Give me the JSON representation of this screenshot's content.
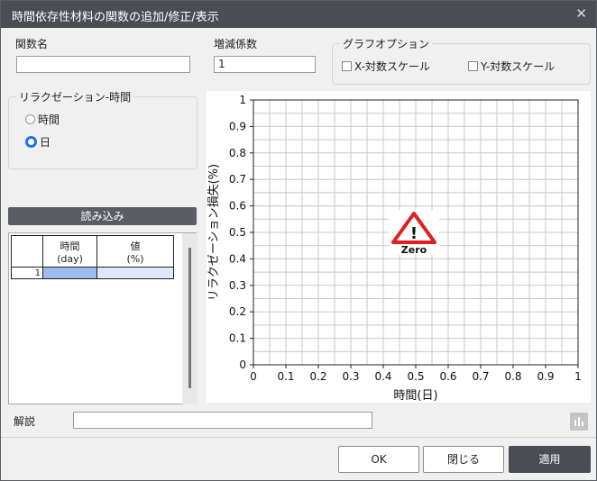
{
  "title": "時間依存性材料の関数の追加/修正/表示",
  "labels": {
    "function_name": "関数名",
    "coefficient": "増減係数",
    "graph_options": "グラフオプション",
    "relaxation_time": "リラクゼーション-時間",
    "description": "解説"
  },
  "inputs": {
    "function_name_value": "",
    "coefficient_value": "1",
    "description_value": ""
  },
  "graph_options": {
    "x_log": {
      "label": "X-対数スケール",
      "checked": false
    },
    "y_log": {
      "label": "Y-対数スケール",
      "checked": false
    }
  },
  "relaxation_units": [
    {
      "label": "時間",
      "selected": false
    },
    {
      "label": "日",
      "selected": true
    }
  ],
  "load_button": "読み込み",
  "table": {
    "headers": [
      [
        "時間",
        "(day)"
      ],
      [
        "値",
        "(%)"
      ]
    ],
    "rows": [
      {
        "index": "1",
        "time": "",
        "value": ""
      }
    ]
  },
  "buttons": {
    "ok": "OK",
    "close": "閉じる",
    "apply": "適用"
  },
  "colors": {
    "title_bg": "#4a4d54",
    "radio_accent": "#1a73e8",
    "warning_red": "#e02020",
    "cell_highlight": "#9cbcf0",
    "cell_light": "#dfe8fb"
  },
  "chart_data": {
    "type": "line",
    "xlabel": "時間(日)",
    "ylabel": "リラクゼーション損失(%)",
    "xlim": [
      0,
      1
    ],
    "ylim": [
      0,
      1
    ],
    "xticks": [
      "0",
      "0.1",
      "0.2",
      "0.3",
      "0.4",
      "0.5",
      "0.6",
      "0.7",
      "0.8",
      "0.9",
      "1"
    ],
    "yticks": [
      "0",
      "0.1",
      "0.2",
      "0.3",
      "0.4",
      "0.5",
      "0.6",
      "0.7",
      "0.8",
      "0.9",
      "1"
    ],
    "grid": true,
    "series": [],
    "annotation": "Zero"
  }
}
